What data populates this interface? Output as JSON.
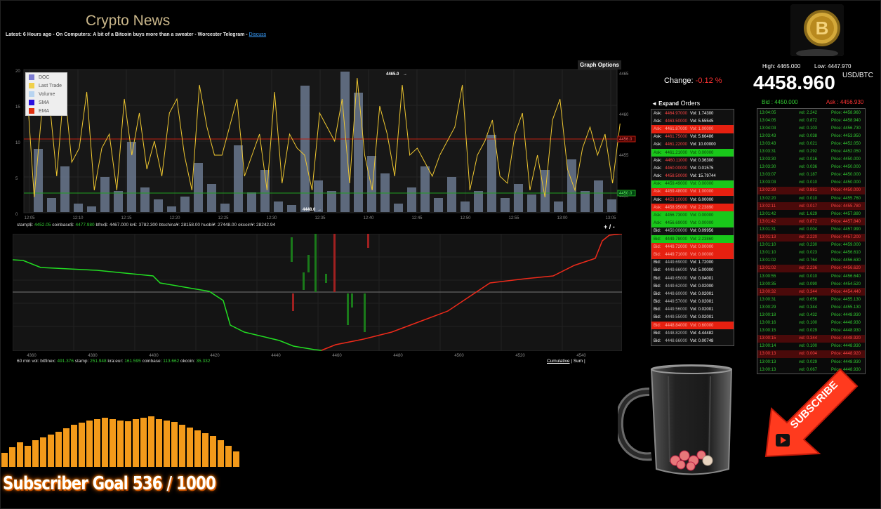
{
  "header": {
    "title": "Crypto News",
    "latest_prefix": "Latest: 6 Hours ago - On Computers: A bit of a Bitcoin buys more than a sweater - Worcester Telegram -",
    "latest_link": "Discuss"
  },
  "price_chart": {
    "graph_options_label": "Graph Options",
    "legend": [
      {
        "label": "DOC",
        "color": "#7a7ad0"
      },
      {
        "label": "Last Trade",
        "color": "#f0d04a"
      },
      {
        "label": "Volume",
        "color": "#b8d4f0"
      },
      {
        "label": "SMA",
        "color": "#2a10e0"
      },
      {
        "label": "EMA",
        "color": "#e03010"
      }
    ],
    "left_ticks": [
      "20",
      "15",
      "10",
      "5",
      "0"
    ],
    "right_ticks": [
      "4465",
      "4460",
      "4455",
      "4450"
    ],
    "time_ticks": [
      "12:05",
      "12:10",
      "12:15",
      "12:20",
      "12:25",
      "12:30",
      "12:35",
      "12:40",
      "12:45",
      "12:50",
      "12:55",
      "13:00",
      "13:05"
    ],
    "high_marker": "4465.0",
    "low_marker": "4448.0",
    "red_tag": "4456.0",
    "green_tag": "4450.0"
  },
  "exchanges": [
    {
      "name": "stamp$:",
      "value": "4452.05",
      "green": true
    },
    {
      "name": "coinbase$:",
      "value": "4477.980",
      "green": true
    },
    {
      "name": "bfnx$:",
      "value": "4467.000",
      "green": false
    },
    {
      "name": "kr€:",
      "value": "3782.300",
      "green": false
    },
    {
      "name": "btcchina¥:",
      "value": "28158.00",
      "green": false
    },
    {
      "name": "huobi¥:",
      "value": "27448.00",
      "green": false
    },
    {
      "name": "okcoin¥:",
      "value": "28242.94",
      "green": false
    }
  ],
  "zoom_label": "+ / -",
  "depth_chart": {
    "left_ticks": [
      "4",
      "2",
      "0",
      "-2",
      "-4"
    ],
    "right_ticks": [
      "800",
      "600",
      "400",
      "200",
      "0"
    ],
    "x_ticks": [
      "4360",
      "4380",
      "4400",
      "4420",
      "4440",
      "4460",
      "4480",
      "4500",
      "4520",
      "4540"
    ]
  },
  "volumes": {
    "prefix": "60 min vol:",
    "items": [
      {
        "name": "bitfinex:",
        "value": "491.376"
      },
      {
        "name": "stamp:",
        "value": "251.948"
      },
      {
        "name": "kra:eur:",
        "value": "161.595"
      },
      {
        "name": "coinbase:",
        "value": "113.662"
      },
      {
        "name": "okcoin:",
        "value": "35.332"
      }
    ],
    "cumulative": "Cumulative",
    "sum": "Sum"
  },
  "change": {
    "label": "Change:",
    "value": "-0.12 %"
  },
  "orders": {
    "expand": "◄ Expand",
    "title": "Orders",
    "rows": [
      {
        "type": "Ask:",
        "price": "4464.97000",
        "vol": "Vol: 1.74300",
        "hl": ""
      },
      {
        "type": "Ask:",
        "price": "4463.50000",
        "vol": "Vol: 5.55545",
        "hl": ""
      },
      {
        "type": "Ask:",
        "price": "4461.87000",
        "vol": "Vol: 1.00000",
        "hl": "red"
      },
      {
        "type": "Ask:",
        "price": "4461.75000",
        "vol": "Vol: 5.66486",
        "hl": ""
      },
      {
        "type": "Ask:",
        "price": "4461.22000",
        "vol": "Vol: 10.00000",
        "hl": ""
      },
      {
        "type": "Ask:",
        "price": "4461.21000",
        "vol": "Vol: 0.00000",
        "hl": "green"
      },
      {
        "type": "Ask:",
        "price": "4460.11000",
        "vol": "Vol: 0.36300",
        "hl": ""
      },
      {
        "type": "Ask:",
        "price": "4460.00000",
        "vol": "Vol: 0.01575",
        "hl": ""
      },
      {
        "type": "Ask:",
        "price": "4458.50000",
        "vol": "Vol: 15.79744",
        "hl": ""
      },
      {
        "type": "Ask:",
        "price": "4459.49000",
        "vol": "Vol: 0.00000",
        "hl": "green"
      },
      {
        "type": "Ask:",
        "price": "4459.48000",
        "vol": "Vol: 1.00000",
        "hl": "red"
      },
      {
        "type": "Ask:",
        "price": "4459.10000",
        "vol": "Vol: 6.00000",
        "hl": ""
      },
      {
        "type": "Ask:",
        "price": "4458.95000",
        "vol": "Vol: 2.23890",
        "hl": "red"
      },
      {
        "type": "Ask:",
        "price": "4456.73000",
        "vol": "Vol: 0.00000",
        "hl": "green"
      },
      {
        "type": "Ask:",
        "price": "4456.69000",
        "vol": "Vol: 0.00000",
        "hl": "green"
      },
      {
        "type": "Bid:",
        "price": "4450.00000",
        "vol": "Vol: 0.09956",
        "hl": ""
      },
      {
        "type": "Bid:",
        "price": "4449.78000",
        "vol": "Vol: 2.23860",
        "hl": "green"
      },
      {
        "type": "Bid:",
        "price": "4449.72000",
        "vol": "Vol: 0.00000",
        "hl": "red"
      },
      {
        "type": "Bid:",
        "price": "4449.71000",
        "vol": "Vol: 0.00000",
        "hl": "red"
      },
      {
        "type": "Bid:",
        "price": "4449.69000",
        "vol": "Vol: 1.72000",
        "hl": ""
      },
      {
        "type": "Bid:",
        "price": "4449.66000",
        "vol": "Vol: 5.00000",
        "hl": ""
      },
      {
        "type": "Bid:",
        "price": "4449.65000",
        "vol": "Vol: 0.04001",
        "hl": ""
      },
      {
        "type": "Bid:",
        "price": "4449.62000",
        "vol": "Vol: 0.02000",
        "hl": ""
      },
      {
        "type": "Bid:",
        "price": "4449.60000",
        "vol": "Vol: 0.02001",
        "hl": ""
      },
      {
        "type": "Bid:",
        "price": "4449.57000",
        "vol": "Vol: 0.02001",
        "hl": ""
      },
      {
        "type": "Bid:",
        "price": "4449.56000",
        "vol": "Vol: 0.02001",
        "hl": ""
      },
      {
        "type": "Bid:",
        "price": "4449.55000",
        "vol": "Vol: 0.02001",
        "hl": ""
      },
      {
        "type": "Bid:",
        "price": "4448.84000",
        "vol": "Vol: 0.60000",
        "hl": "red"
      },
      {
        "type": "Bid:",
        "price": "4448.82000",
        "vol": "Vol: 4.44482",
        "hl": ""
      },
      {
        "type": "Bid:",
        "price": "4448.66000",
        "vol": "Vol: 0.00748",
        "hl": ""
      }
    ]
  },
  "ticker": {
    "high": "High: 4465.000",
    "low": "Low: 4447.970",
    "price": "4458.960",
    "pair": "USD/BTC",
    "bid": "Bid : 4450.000",
    "ask": "Ask : 4456.930"
  },
  "trades": [
    {
      "time": "13:04:05",
      "vol": "vol: 2.242",
      "price": "Price: 4458.960",
      "side": "buy"
    },
    {
      "time": "13:04:05",
      "vol": "vol: 0.872",
      "price": "Price: 4458.940",
      "side": "buy"
    },
    {
      "time": "13:04:03",
      "vol": "vol: 0.103",
      "price": "Price: 4456.730",
      "side": "buy"
    },
    {
      "time": "13:03:43",
      "vol": "vol: 0.038",
      "price": "Price: 4453.950",
      "side": "buy"
    },
    {
      "time": "13:03:43",
      "vol": "vol: 0.021",
      "price": "Price: 4452.050",
      "side": "buy"
    },
    {
      "time": "13:03:31",
      "vol": "vol: 0.292",
      "price": "Price: 4452.050",
      "side": "buy"
    },
    {
      "time": "13:03:30",
      "vol": "vol: 0.016",
      "price": "Price: 4450.000",
      "side": "buy"
    },
    {
      "time": "13:03:30",
      "vol": "vol: 0.036",
      "price": "Price: 4450.000",
      "side": "buy"
    },
    {
      "time": "13:03:07",
      "vol": "vol: 0.187",
      "price": "Price: 4450.000",
      "side": "buy"
    },
    {
      "time": "13:03:03",
      "vol": "vol: 0.010",
      "price": "Price: 4450.000",
      "side": "buy"
    },
    {
      "time": "13:02:39",
      "vol": "vol: 0.881",
      "price": "Price: 4450.000",
      "side": "sell"
    },
    {
      "time": "13:02:20",
      "vol": "vol: 0.010",
      "price": "Price: 4455.760",
      "side": "buy"
    },
    {
      "time": "13:02:11",
      "vol": "vol: 0.017",
      "price": "Price: 4455.780",
      "side": "sell"
    },
    {
      "time": "13:01:42",
      "vol": "vol: 1.629",
      "price": "Price: 4457.880",
      "side": "buy"
    },
    {
      "time": "13:01:42",
      "vol": "vol: 0.872",
      "price": "Price: 4457.840",
      "side": "sell"
    },
    {
      "time": "13:01:31",
      "vol": "vol: 0.004",
      "price": "Price: 4457.990",
      "side": "buy"
    },
    {
      "time": "13:01:13",
      "vol": "vol: 2.220",
      "price": "Price: 4457.200",
      "side": "sell"
    },
    {
      "time": "13:01:10",
      "vol": "vol: 0.230",
      "price": "Price: 4459.000",
      "side": "buy"
    },
    {
      "time": "13:01:10",
      "vol": "vol: 0.023",
      "price": "Price: 4456.610",
      "side": "buy"
    },
    {
      "time": "13:01:02",
      "vol": "vol: 0.764",
      "price": "Price: 4456.630",
      "side": "buy"
    },
    {
      "time": "13:01:02",
      "vol": "vol: 2.236",
      "price": "Price: 4456.620",
      "side": "sell"
    },
    {
      "time": "13:00:55",
      "vol": "vol: 0.010",
      "price": "Price: 4456.640",
      "side": "buy"
    },
    {
      "time": "13:00:35",
      "vol": "vol: 0.090",
      "price": "Price: 4454.520",
      "side": "buy"
    },
    {
      "time": "13:00:32",
      "vol": "vol: 0.344",
      "price": "Price: 4454.440",
      "side": "sell"
    },
    {
      "time": "13:00:31",
      "vol": "vol: 0.656",
      "price": "Price: 4455.130",
      "side": "buy"
    },
    {
      "time": "13:00:29",
      "vol": "vol: 0.344",
      "price": "Price: 4455.130",
      "side": "buy"
    },
    {
      "time": "13:00:18",
      "vol": "vol: 0.432",
      "price": "Price: 4448.930",
      "side": "buy"
    },
    {
      "time": "13:00:16",
      "vol": "vol: 0.100",
      "price": "Price: 4448.930",
      "side": "buy"
    },
    {
      "time": "13:00:15",
      "vol": "vol: 0.029",
      "price": "Price: 4448.930",
      "side": "buy"
    },
    {
      "time": "13:00:15",
      "vol": "vol: 0.344",
      "price": "Price: 4448.920",
      "side": "sell"
    },
    {
      "time": "13:00:14",
      "vol": "vol: 0.100",
      "price": "Price: 4448.930",
      "side": "buy"
    },
    {
      "time": "13:00:13",
      "vol": "vol: 0.004",
      "price": "Price: 4448.920",
      "side": "sell"
    },
    {
      "time": "13:00:13",
      "vol": "vol: 0.029",
      "price": "Price: 4448.930",
      "side": "buy"
    },
    {
      "time": "13:00:13",
      "vol": "vol: 0.067",
      "price": "Price: 4448.930",
      "side": "buy"
    }
  ],
  "overlay": {
    "goal_text": "Subscriber Goal 536 / 1000",
    "subscribe_text": "SUBSCRIBE"
  },
  "colors": {
    "ask": "#f44444",
    "bid_green": "#33cc33",
    "accent_gold": "#c9b68a",
    "goal_orange": "#f39a1a"
  },
  "icons": [
    "bitcoin-logo-icon",
    "play-icon",
    "tip-jar-icon",
    "subscribe-arrow-icon"
  ]
}
